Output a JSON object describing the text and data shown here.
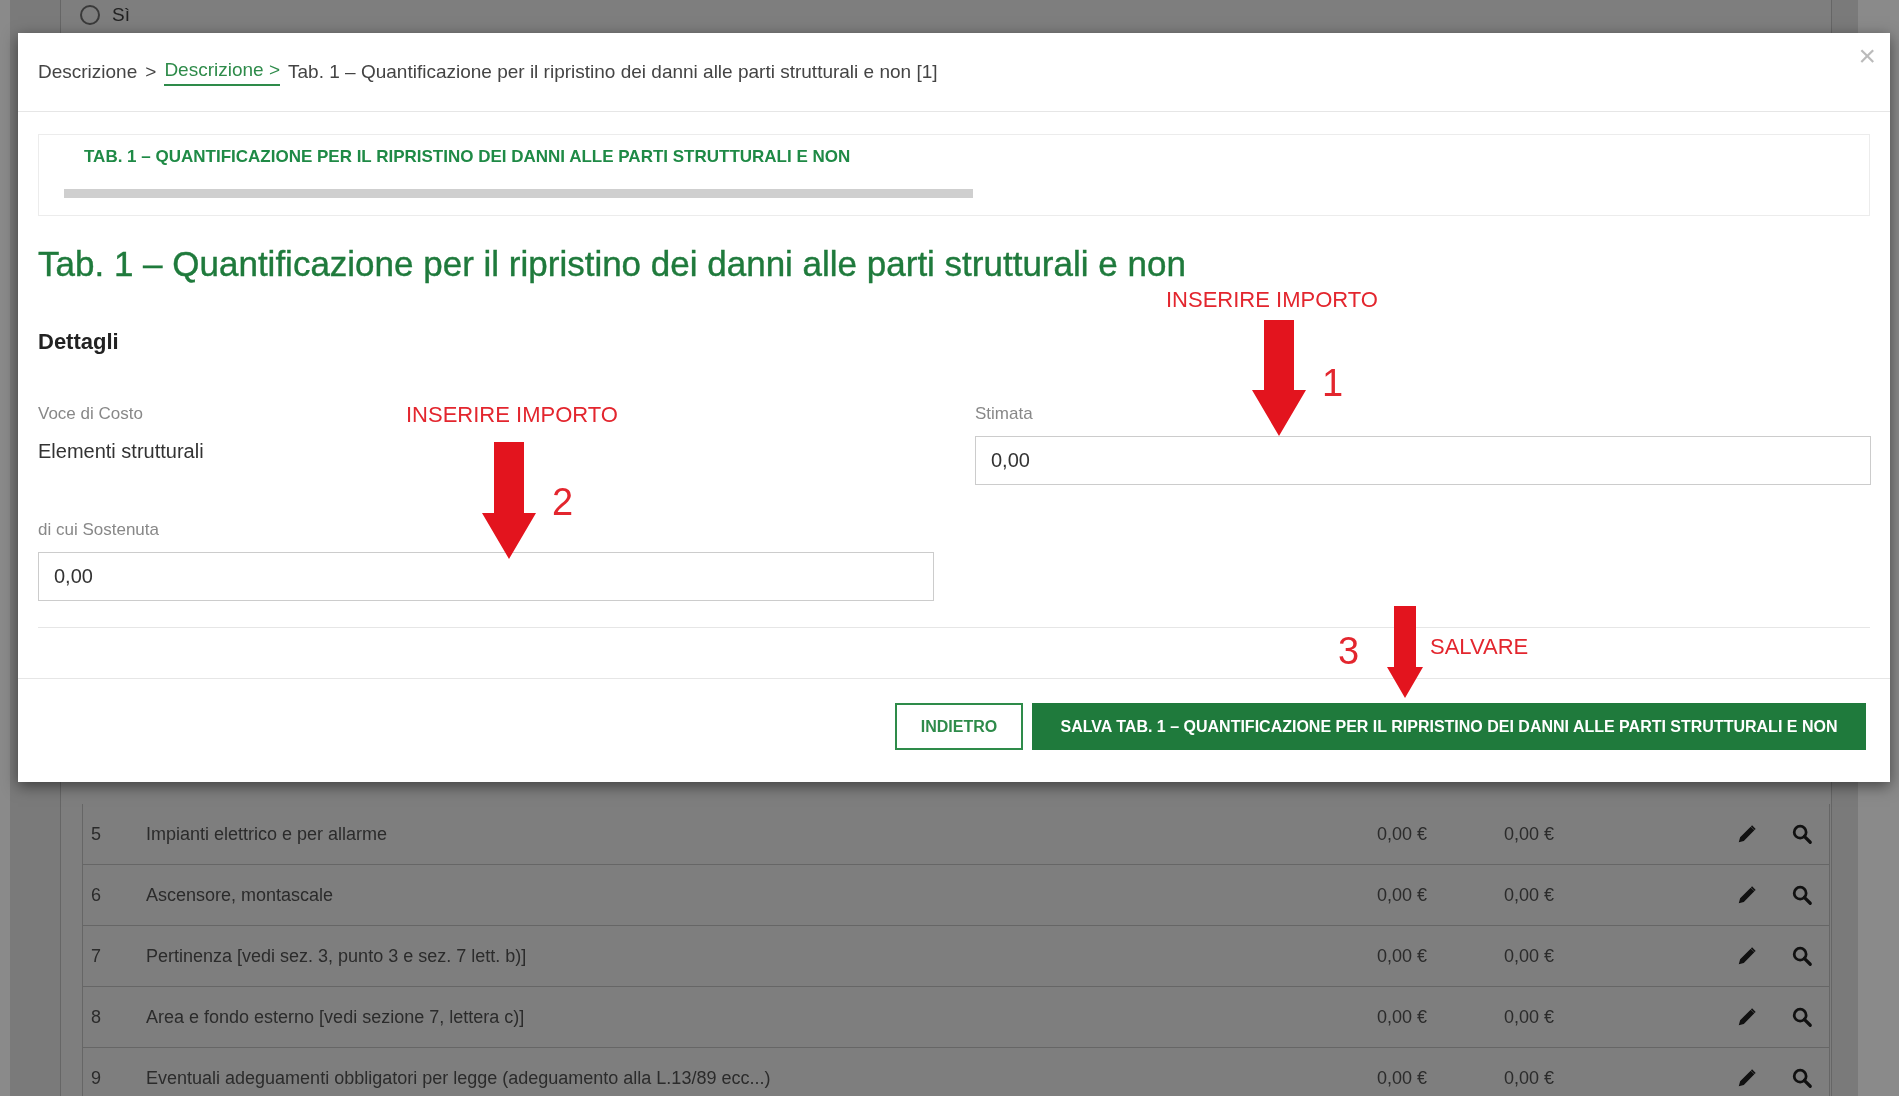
{
  "background": {
    "radio": {
      "label": "Sì",
      "checked": false
    },
    "rows": [
      {
        "number": "5",
        "description": "Impianti elettrico e per allarme",
        "amount_1": "0,00 €",
        "amount_2": "0,00 €"
      },
      {
        "number": "6",
        "description": "Ascensore, montascale",
        "amount_1": "0,00 €",
        "amount_2": "0,00 €"
      },
      {
        "number": "7",
        "description": "Pertinenza [vedi sez. 3, punto 3 e sez. 7 lett. b)]",
        "amount_1": "0,00 €",
        "amount_2": "0,00 €"
      },
      {
        "number": "8",
        "description": "Area e fondo esterno [vedi sezione 7, lettera c)]",
        "amount_1": "0,00 €",
        "amount_2": "0,00 €"
      },
      {
        "number": "9",
        "description": "Eventuali adeguamenti obbligatori per legge (adeguamento alla L.13/89 ecc...)",
        "amount_1": "0,00 €",
        "amount_2": "0,00 €"
      }
    ]
  },
  "modal": {
    "close": "×",
    "breadcrumb": {
      "separator": ">",
      "items": [
        {
          "label": "Descrizione",
          "link": false
        },
        {
          "label": "Descrizione",
          "link": true
        },
        {
          "label": "Tab. 1 – Quantificazione per il ripristino dei danni alle parti strutturali e non [1]",
          "link": false
        }
      ]
    },
    "tabs": [
      {
        "label": "TAB. 1 – QUANTIFICAZIONE PER IL RIPRISTINO DEI DANNI ALLE PARTI STRUTTURALI E NON",
        "selected": true
      }
    ],
    "heading": "Tab. 1 – Quantificazione per il ripristino dei danni alle parti strutturali e non",
    "section": "Dettagli",
    "fields": [
      {
        "label": "Voce di Costo",
        "kind": "text",
        "value": "Elementi strutturali"
      },
      {
        "label": "Stimata",
        "kind": "input",
        "value": "0,00"
      },
      {
        "label": "di cui Sostenuta",
        "kind": "input",
        "value": "0,00"
      }
    ],
    "buttons": [
      {
        "label": "INDIETRO",
        "kind": "secondary"
      },
      {
        "label": "SALVA TAB. 1 – QUANTIFICAZIONE PER IL RIPRISTINO DEI DANNI ALLE PARTI STRUTTURALI E NON",
        "kind": "primary"
      }
    ]
  },
  "annotations": [
    {
      "label": "INSERIRE IMPORTO",
      "number": "1"
    },
    {
      "label": "INSERIRE IMPORTO",
      "number": "2"
    },
    {
      "label": "SALVARE",
      "number": "3"
    }
  ]
}
